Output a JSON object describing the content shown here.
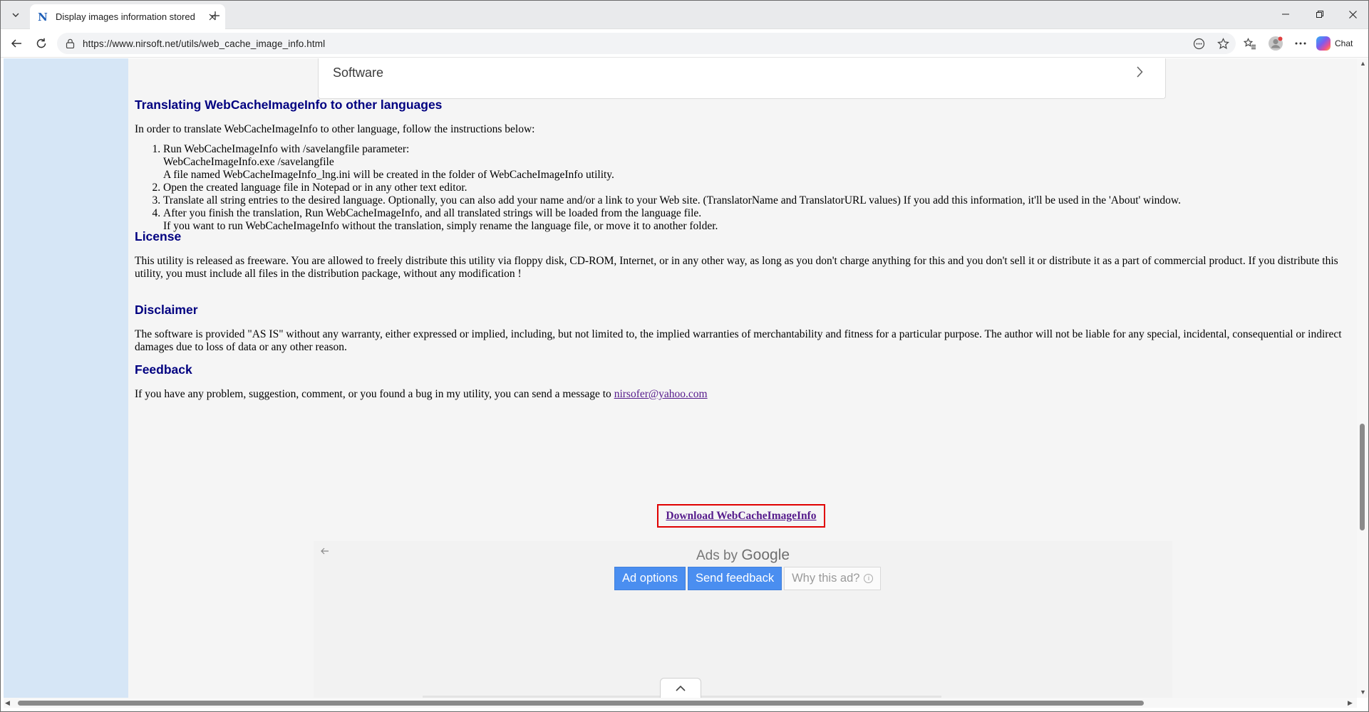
{
  "browser": {
    "tab_title": "Display images information stored",
    "url": "https://www.nirsoft.net/utils/web_cache_image_info.html",
    "chat_label": "Chat",
    "favicon_letter": "N"
  },
  "page": {
    "software_card_label": "Software",
    "translate": {
      "heading": "Translating WebCacheImageInfo to other languages",
      "intro": "In order to translate WebCacheImageInfo to other language, follow the instructions below:",
      "steps": [
        {
          "line1": "Run WebCacheImageInfo with /savelangfile parameter:",
          "line2": "WebCacheImageInfo.exe /savelangfile",
          "line3": "A file named WebCacheImageInfo_lng.ini will be created in the folder of WebCacheImageInfo utility."
        },
        {
          "line1": "Open the created language file in Notepad or in any other text editor."
        },
        {
          "line1": "Translate all string entries to the desired language. Optionally, you can also add your name and/or a link to your Web site. (TranslatorName and TranslatorURL values) If you add this information, it'll be used in the 'About' window."
        },
        {
          "line1": "After you finish the translation, Run WebCacheImageInfo, and all translated strings will be loaded from the language file.",
          "line2": "If you want to run WebCacheImageInfo without the translation, simply rename the language file, or move it to another folder."
        }
      ]
    },
    "license": {
      "heading": "License",
      "text": "This utility is released as freeware. You are allowed to freely distribute this utility via floppy disk, CD-ROM, Internet, or in any other way, as long as you don't charge anything for this and you don't sell it or distribute it as a part of commercial product. If you distribute this utility, you must include all files in the distribution package, without any modification !"
    },
    "disclaimer": {
      "heading": "Disclaimer",
      "text": "The software is provided \"AS IS\" without any warranty, either expressed or implied, including, but not limited to, the implied warranties of merchantability and fitness for a particular purpose. The author will not be liable for any special, incidental, consequential or indirect damages due to loss of data or any other reason."
    },
    "feedback": {
      "heading": "Feedback",
      "text": "If you have any problem, suggestion, comment, or you found a bug in my utility, you can send a message to ",
      "email": "nirsofer@yahoo.com"
    },
    "download_label": "Download WebCacheImageInfo",
    "ads": {
      "ads_by": "Ads by",
      "google": "Google",
      "ad_options": "Ad options",
      "send_feedback": "Send feedback",
      "why_this_ad": "Why this ad?"
    }
  },
  "colors": {
    "heading": "#000080",
    "left_column": "#d6e6f6",
    "download_border": "#e00000",
    "ad_button": "#4a8ef0"
  }
}
